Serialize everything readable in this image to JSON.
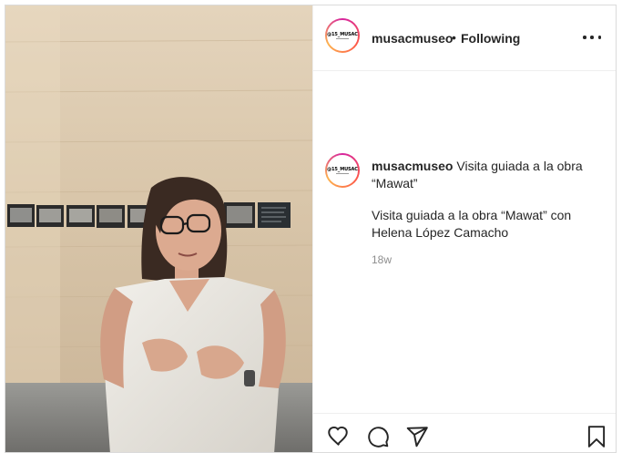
{
  "post": {
    "username": "musacmuseo",
    "follow_separator": "•",
    "follow_status": "Following",
    "avatar_text": "@15_MUSAC",
    "caption_title": "Visita guiada a la obra “Mawat”",
    "caption_body": "Visita guiada a la obra “Mawat” con Helena López Camacho",
    "age": "18w"
  },
  "icons": {
    "more": "more-options-icon",
    "like": "heart-icon",
    "comment": "comment-icon",
    "share": "send-icon",
    "save": "bookmark-icon"
  },
  "colors": {
    "text": "#262626",
    "muted": "#8e8e8e",
    "border": "#dbdbdb"
  }
}
